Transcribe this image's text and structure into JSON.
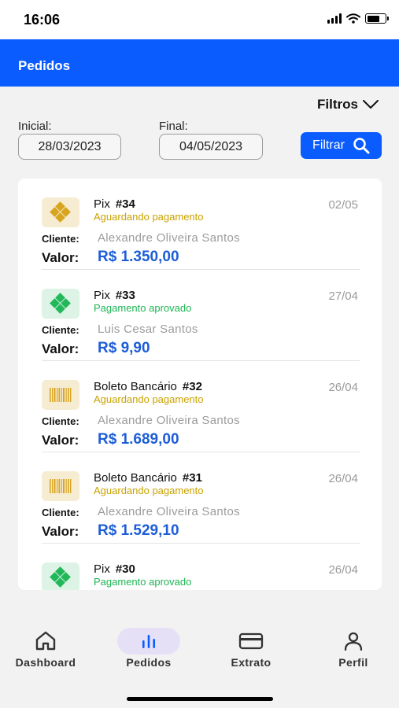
{
  "status_bar": {
    "time": "16:06"
  },
  "header": {
    "title": "Pedidos"
  },
  "filters": {
    "toggle_label": "Filtros",
    "start_label": "Inicial:",
    "start_value": "28/03/2023",
    "end_label": "Final:",
    "end_value": "04/05/2023",
    "filter_button": "Filtrar"
  },
  "orders": {
    "client_label": "Cliente:",
    "value_label": "Valor:",
    "items": [
      {
        "method": "Pix",
        "number": "#34",
        "status": "Aguardando pagamento",
        "date": "02/05",
        "client": "Alexandre Oliveira Santos",
        "value": "R$ 1.350,00",
        "icon": "pix-icon"
      },
      {
        "method": "Pix",
        "number": "#33",
        "status": "Pagamento aprovado",
        "date": "27/04",
        "client": "Luis Cesar Santos",
        "value": "R$ 9,90",
        "icon": "pix-icon"
      },
      {
        "method": "Boleto Bancário",
        "number": "#32",
        "status": "Aguardando pagamento",
        "date": "26/04",
        "client": "Alexandre Oliveira Santos",
        "value": "R$ 1.689,00",
        "icon": "barcode-icon"
      },
      {
        "method": "Boleto Bancário",
        "number": "#31",
        "status": "Aguardando pagamento",
        "date": "26/04",
        "client": "Alexandre Oliveira Santos",
        "value": "R$ 1.529,10",
        "icon": "barcode-icon"
      },
      {
        "method": "Pix",
        "number": "#30",
        "status": "Pagamento aprovado",
        "date": "26/04",
        "client": "",
        "value": "",
        "icon": "pix-icon"
      }
    ]
  },
  "tabs": [
    {
      "label": "Dashboard",
      "icon": "home-icon"
    },
    {
      "label": "Pedidos",
      "icon": "bar-chart-icon",
      "active": true
    },
    {
      "label": "Extrato",
      "icon": "card-icon"
    },
    {
      "label": "Perfil",
      "icon": "person-icon"
    }
  ],
  "colors": {
    "primary": "#0a5cff",
    "pending": "#c9a300",
    "approved": "#1db554",
    "value": "#1d5dd8"
  }
}
